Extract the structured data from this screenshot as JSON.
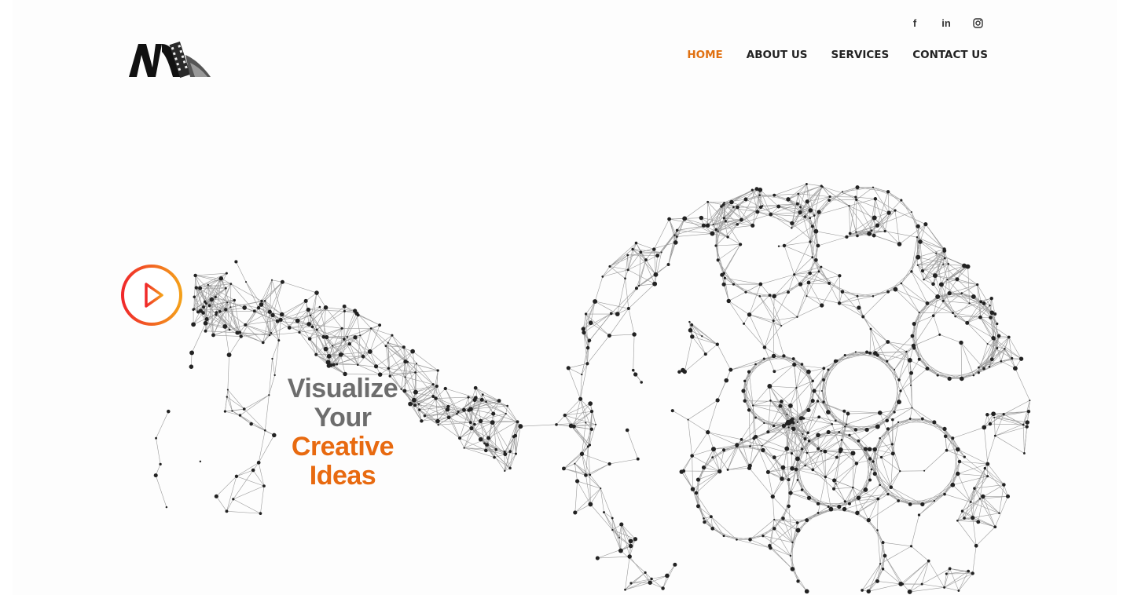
{
  "header": {
    "social": [
      {
        "icon": "facebook-icon",
        "glyph": "f"
      },
      {
        "icon": "linkedin-icon",
        "glyph": "in"
      },
      {
        "icon": "instagram-icon",
        "glyph": ""
      }
    ],
    "nav": [
      {
        "label": "HOME",
        "active": true
      },
      {
        "label": "ABOUT US",
        "active": false
      },
      {
        "label": "SERVICES",
        "active": false
      },
      {
        "label": "CONTACT US",
        "active": false
      }
    ]
  },
  "hero": {
    "tagline": {
      "line1": "Visualize",
      "line2": "Your",
      "line3": "Creative",
      "line4": "Ideas"
    },
    "play_icon": "play-icon"
  },
  "colors": {
    "accent": "#e07010",
    "play_gradient_start": "#f0282a",
    "play_gradient_end": "#f4a01a",
    "nav_text": "#222222",
    "tagline_grey": "#6d6d6d",
    "tagline_orange": "#e86a10"
  }
}
